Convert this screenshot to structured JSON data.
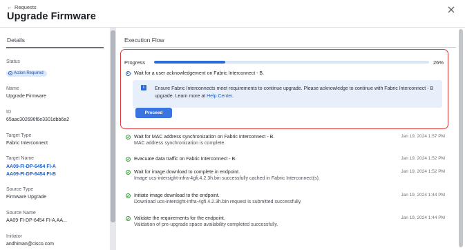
{
  "header": {
    "back_label": "Requests",
    "title": "Upgrade Firmware"
  },
  "details": {
    "heading": "Details",
    "fields": [
      {
        "label": "Status",
        "badge": "Action Required"
      },
      {
        "label": "Name",
        "value": "Upgrade Firmware"
      },
      {
        "label": "ID",
        "value": "65aac302696f6e3301dbb6a2"
      },
      {
        "label": "Target Type",
        "value": "Fabric Interconnect"
      },
      {
        "label": "Target Name",
        "links": [
          "AA09-FI-DP-6454 FI-A",
          "AA09-FI-DP-6454 FI-B"
        ]
      },
      {
        "label": "Source Type",
        "value": "Firmware Upgrade"
      },
      {
        "label": "Source Name",
        "value": "AA09-FI-DP-6454 FI-A,AA..."
      },
      {
        "label": "Initiator",
        "value": "andhiman@cisco.com"
      }
    ]
  },
  "execution": {
    "heading": "Execution Flow",
    "progress_label": "Progress",
    "progress_value": 0.26,
    "progress_text": "26%",
    "active_step": {
      "title": "Wait for a user acknowledgement on Fabric Interconnect - B.",
      "info_text": "Ensure Fabric Interconnects meet requirements to continue upgrade. Please acknowledge to continue with Fabric Interconnect - B upgrade. Learn more at ",
      "info_link": "Help Center",
      "info_tail": ".",
      "button_label": "Proceed"
    },
    "steps": [
      {
        "title": "Wait for MAC address synchronization on Fabric Interconnect - B.",
        "desc": "MAC address synchronization is complete.",
        "time": "Jan 19, 2024 1:57 PM"
      },
      {
        "title": "Evacuate data traffic on Fabric Interconnect - B.",
        "desc": "",
        "time": "Jan 19, 2024 1:52 PM"
      },
      {
        "title": "Wait for image download to complete in endpoint.",
        "desc": "Image ucs-intersight-infra-4gfi.4.2.3h.bin successfully cached in Fabric Interconnect(s).",
        "time": "Jan 19, 2024 1:52 PM"
      },
      {
        "title": "Initiate image download to the endpoint.",
        "desc": "Download ucs-intersight-infra-4gfi.4.2.3h.bin request is submitted successfully.",
        "time": "Jan 19, 2024 1:44 PM"
      },
      {
        "title": "Validate the requirements for the endpoint.",
        "desc": "Validation of pre-upgrade space availability completed successfully.",
        "time": "Jan 19, 2024 1:44 PM"
      }
    ]
  },
  "colors": {
    "accent": "#2f6bd6",
    "highlight_border": "#d93a3a",
    "success": "#3c9a3c",
    "badge_bg": "#dbe7fb"
  },
  "icons": {
    "back": "arrow-left-icon",
    "close": "close-icon",
    "status": "info-circle-icon",
    "active_step": "radio-dot-icon",
    "info": "info-square-icon",
    "completed_step": "check-circle-icon"
  }
}
